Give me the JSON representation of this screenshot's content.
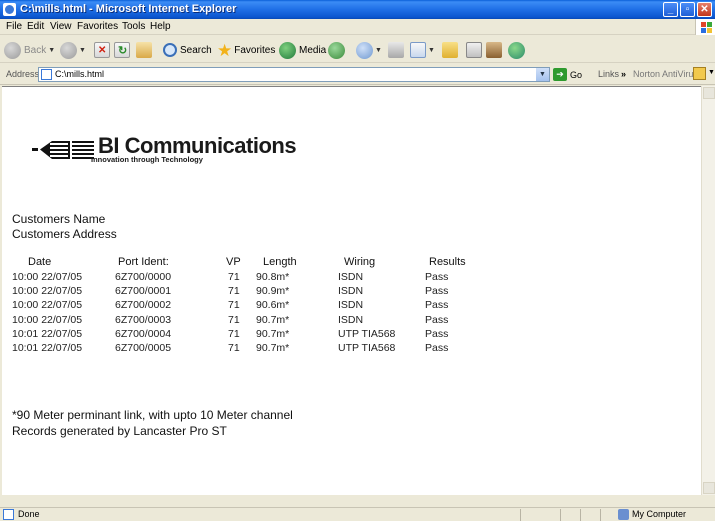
{
  "window": {
    "title": "C:\\mills.html - Microsoft Internet Explorer",
    "minimize_glyph": "_",
    "maximize_glyph": "▫",
    "close_glyph": "✕"
  },
  "menu": [
    "File",
    "Edit",
    "View",
    "Favorites",
    "Tools",
    "Help"
  ],
  "toolbar": {
    "back_label": "Back",
    "search_label": "Search",
    "favorites_label": "Favorites",
    "media_label": "Media"
  },
  "address": {
    "label": "Address",
    "value": "C:\\mills.html",
    "go_label": "Go",
    "links_label": "Links",
    "chevron": "»",
    "norton_label": "Norton AntiVirus"
  },
  "page": {
    "logo_name": "BI Communications",
    "logo_tagline": "Innovation through Technology",
    "customer_name": "Customers Name",
    "customer_address": "Customers Address",
    "table": {
      "headers": [
        "Date",
        "Port Ident:",
        "VP",
        "Length",
        "Wiring",
        "Results"
      ],
      "rows": [
        [
          "10:00 22/07/05",
          "6Z700/0000",
          "71",
          "90.8m*",
          "ISDN",
          "Pass"
        ],
        [
          "10:00 22/07/05",
          "6Z700/0001",
          "71",
          "90.9m*",
          "ISDN",
          "Pass"
        ],
        [
          "10:00 22/07/05",
          "6Z700/0002",
          "71",
          "90.6m*",
          "ISDN",
          "Pass"
        ],
        [
          "10:00 22/07/05",
          "6Z700/0003",
          "71",
          "90.7m*",
          "ISDN",
          "Pass"
        ],
        [
          "10:01 22/07/05",
          "6Z700/0004",
          "71",
          "90.7m*",
          "UTP TIA568",
          "Pass"
        ],
        [
          "10:01 22/07/05",
          "6Z700/0005",
          "71",
          "90.7m*",
          "UTP TIA568",
          "Pass"
        ]
      ]
    },
    "note_1": "*90 Meter perminant link, with upto 10 Meter channel",
    "note_2": "Records generated by Lancaster Pro ST"
  },
  "status": {
    "text": "Done",
    "zone": "My Computer"
  },
  "colors": {
    "titlebar": "#0b56cf",
    "background": "#ece9d8",
    "content": "#ffffff"
  }
}
